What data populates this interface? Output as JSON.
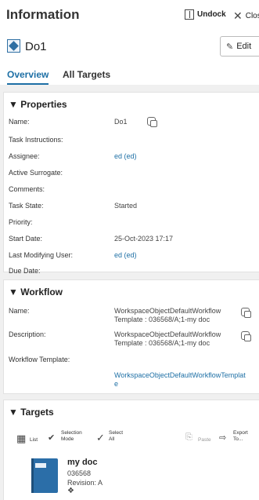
{
  "header": {
    "title": "Information",
    "undock_label": "Undock",
    "close_label": "Close"
  },
  "object": {
    "name": "Do1",
    "edit_label": "Edit"
  },
  "tabs": [
    {
      "label": "Overview",
      "active": true
    },
    {
      "label": "All Targets",
      "active": false
    }
  ],
  "properties": {
    "title": "▼ Properties",
    "rows": [
      {
        "label": "Name:",
        "value": "Do1"
      },
      {
        "label": "Task Instructions:",
        "value": ""
      },
      {
        "label": "Assignee:",
        "value": "ed (ed)"
      },
      {
        "label": "Active Surrogate:",
        "value": ""
      },
      {
        "label": "Comments:",
        "value": ""
      },
      {
        "label": "Task State:",
        "value": "Started"
      },
      {
        "label": "Priority:",
        "value": ""
      },
      {
        "label": "Start Date:",
        "value": "25-Oct-2023 17:17"
      },
      {
        "label": "Last Modifying User:",
        "value": "ed (ed)"
      },
      {
        "label": "Due Date:",
        "value": ""
      }
    ]
  },
  "workflow": {
    "title": "▼ Workflow",
    "name_label": "Name:",
    "name_value_1": "WorkspaceObjectDefaultWorkflow",
    "name_value_2": "Template : 036568/A;1-my doc",
    "desc_label": "Description:",
    "desc_value_1": "WorkspaceObjectDefaultWorkflow",
    "desc_value_2": "Template : 036568/A;1-my doc",
    "template_label": "Workflow Template:",
    "template_value_1": "WorkspaceObjectDefaultWorkflowTemplat",
    "template_value_2": "e"
  },
  "targets": {
    "title": "▼ Targets",
    "toolbar": {
      "list": "List",
      "selection_mode_1": "Selection",
      "selection_mode_2": "Mode",
      "select_all_1": "Select",
      "select_all_2": "All",
      "paste": "Paste",
      "export_1": "Export",
      "export_2": "To..."
    },
    "item": {
      "name": "my doc",
      "id": "036568",
      "revision_label": "Revision:",
      "revision_value": "A"
    }
  },
  "colors": {
    "accent": "#1d6fa5",
    "doc_icon": "#2b6ea8"
  }
}
